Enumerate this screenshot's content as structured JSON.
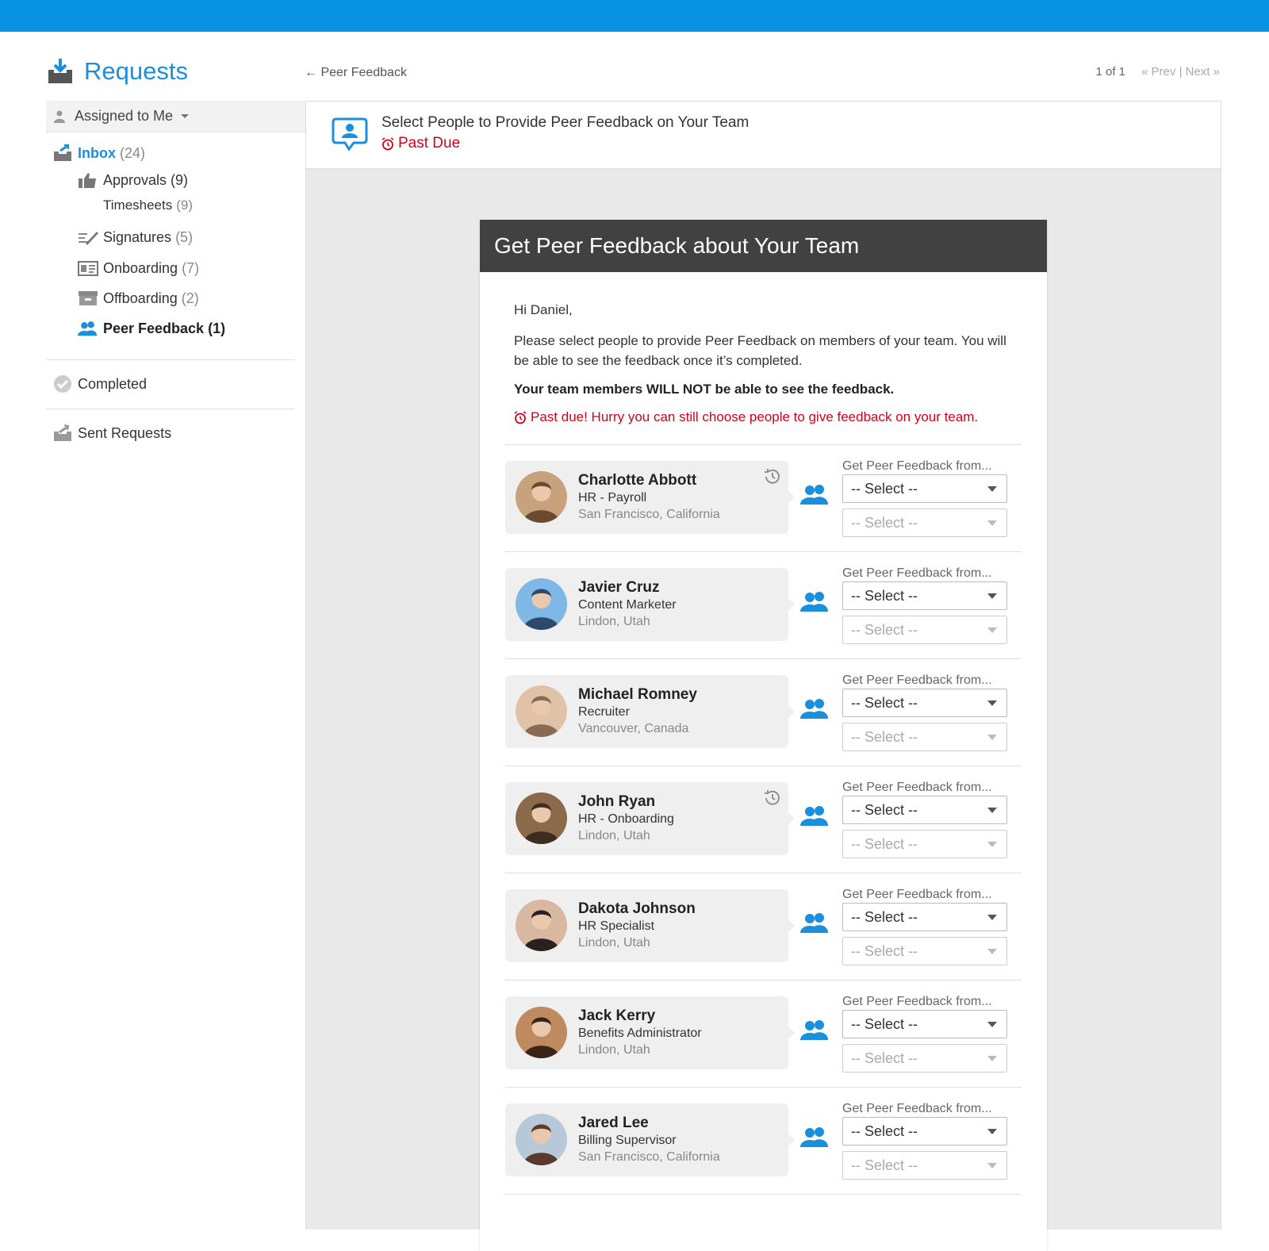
{
  "app": {
    "title": "Requests"
  },
  "breadcrumb": {
    "back_label": "← Peer Feedback"
  },
  "pager": {
    "count": "1 of 1",
    "prev": "« Prev",
    "separator": "|",
    "next": "Next »"
  },
  "sidebar": {
    "filter": "Assigned to Me",
    "inbox": {
      "label": "Inbox",
      "count": "(24)"
    },
    "items": [
      {
        "label": "Approvals",
        "count": "(9)",
        "icon": "thumbs-up-icon"
      },
      {
        "label": "Timesheets",
        "count": "(9)",
        "icon": ""
      },
      {
        "label": "Signatures",
        "count": "(5)",
        "icon": "signature-icon"
      },
      {
        "label": "Onboarding",
        "count": "(7)",
        "icon": "id-card-icon"
      },
      {
        "label": "Offboarding",
        "count": "(2)",
        "icon": "box-icon"
      },
      {
        "label": "Peer Feedback",
        "count": "(1)",
        "icon": "people-icon"
      }
    ],
    "completed": "Completed",
    "sent": "Sent Requests"
  },
  "request": {
    "title": "Select People to Provide Peer Feedback on Your Team",
    "status": "Past Due"
  },
  "card": {
    "header": "Get Peer Feedback about Your Team",
    "greeting": "Hi Daniel,",
    "intro": "Please select people to provide Peer Feedback on members of your team. You will be able to see the feedback once it’s completed.",
    "note": "Your team members WILL NOT be able to see the feedback.",
    "warning": "Past due! Hurry you can still choose people to give feedback on your team."
  },
  "feedback_label": "Get Peer Feedback from...",
  "select_placeholder": "-- Select --",
  "people": [
    {
      "name": "Charlotte Abbott",
      "title": "HR - Payroll",
      "location": "San Francisco, California",
      "history": true
    },
    {
      "name": "Javier Cruz",
      "title": "Content Marketer",
      "location": "Lindon, Utah",
      "history": false
    },
    {
      "name": "Michael Romney",
      "title": "Recruiter",
      "location": "Vancouver, Canada",
      "history": false
    },
    {
      "name": "John Ryan",
      "title": "HR - Onboarding",
      "location": "Lindon, Utah",
      "history": true
    },
    {
      "name": "Dakota Johnson",
      "title": "HR Specialist",
      "location": "Lindon, Utah",
      "history": false
    },
    {
      "name": "Jack Kerry",
      "title": "Benefits Administrator",
      "location": "Lindon, Utah",
      "history": false
    },
    {
      "name": "Jared Lee",
      "title": "Billing Supervisor",
      "location": "San Francisco, California",
      "history": false
    }
  ],
  "colors": {
    "brand": "#0793e2",
    "link": "#1a8fdc",
    "danger": "#d0021b",
    "header_dark": "#414141"
  }
}
